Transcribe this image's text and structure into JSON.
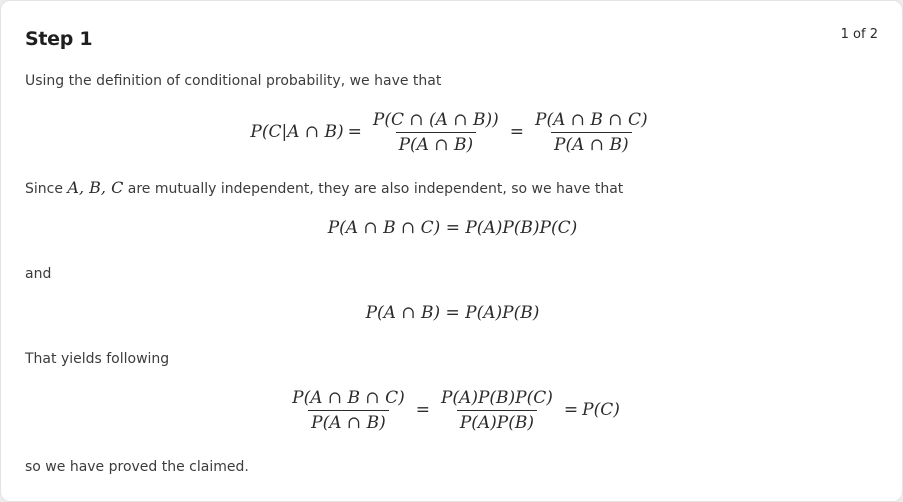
{
  "header": {
    "title": "Step 1",
    "page_indicator": "1 of 2"
  },
  "content": {
    "para1": "Using the definition of conditional probability, we have that",
    "eq1": {
      "lhs": "P(C|A ∩ B)",
      "eq_sign_1": "=",
      "frac1_num": "P(C ∩ (A ∩ B))",
      "frac1_den": "P(A ∩ B)",
      "eq_sign_2": "=",
      "frac2_num": "P(A ∩ B ∩ C)",
      "frac2_den": "P(A ∩ B)"
    },
    "para2_prefix": "Since ",
    "para2_math": "A, B, C",
    "para2_suffix": " are mutually independent, they are also independent, so we have that",
    "eq2": "P(A ∩ B ∩ C) = P(A)P(B)P(C)",
    "para3": "and",
    "eq3": "P(A ∩ B) = P(A)P(B)",
    "para4": "That yields following",
    "eq4": {
      "frac1_num": "P(A ∩ B ∩ C)",
      "frac1_den": "P(A ∩ B)",
      "eq_sign_1": "=",
      "frac2_num": "P(A)P(B)P(C)",
      "frac2_den": "P(A)P(B)",
      "eq_sign_2": "=",
      "rhs": "P(C)"
    },
    "para5": "so we have proved the claimed."
  },
  "colors": {
    "background": "#ffffff",
    "text": "#3c3c3c",
    "title": "#1f1f1f"
  }
}
